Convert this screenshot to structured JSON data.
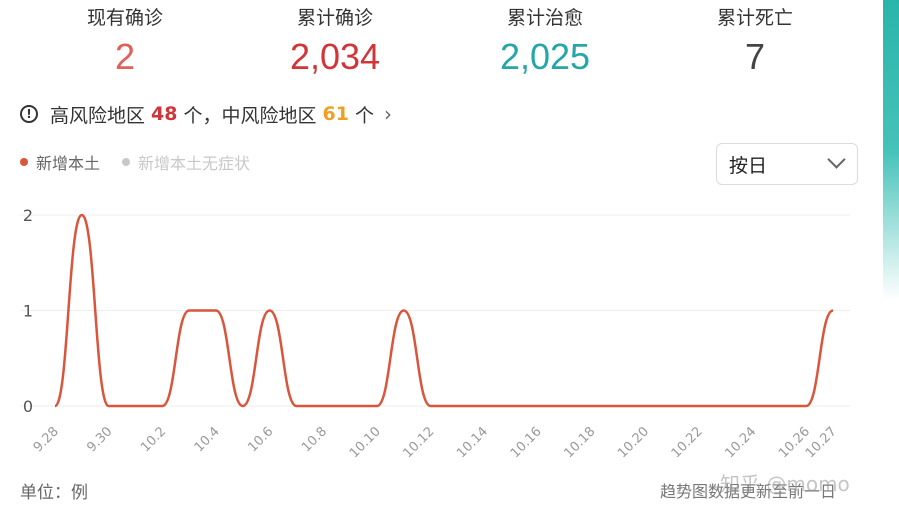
{
  "stats": [
    {
      "label": "现有确诊",
      "value": "2"
    },
    {
      "label": "累计确诊",
      "value": "2,034"
    },
    {
      "label": "累计治愈",
      "value": "2,025"
    },
    {
      "label": "累计死亡",
      "value": "7"
    }
  ],
  "risk": {
    "icon": "!",
    "high_label": "高风险地区",
    "high_count": "48",
    "high_unit": "个，",
    "mid_label": "中风险地区",
    "mid_count": "61",
    "mid_unit": "个",
    "arrow": "›"
  },
  "select": {
    "value": "按日"
  },
  "footer": {
    "unit": "单位：例",
    "note": "趋势图数据更新至前一日",
    "watermark": "知乎 @momo"
  },
  "colors": {
    "series_active": "#d9553c",
    "series_inactive": "#c8c8c8",
    "grid": "#eeeeee"
  },
  "chart_data": {
    "type": "line",
    "ylim": [
      0,
      2
    ],
    "yticks": [
      "0",
      "1",
      "2"
    ],
    "xticks": [
      "9.28",
      "9.30",
      "10.2",
      "10.4",
      "10.6",
      "10.8",
      "10.10",
      "10.12",
      "10.14",
      "10.16",
      "10.18",
      "10.20",
      "10.22",
      "10.24",
      "10.26",
      "10.27"
    ],
    "x": [
      "9.28",
      "9.29",
      "9.30",
      "10.1",
      "10.2",
      "10.3",
      "10.4",
      "10.5",
      "10.6",
      "10.7",
      "10.8",
      "10.9",
      "10.10",
      "10.11",
      "10.12",
      "10.13",
      "10.14",
      "10.15",
      "10.16",
      "10.17",
      "10.18",
      "10.19",
      "10.20",
      "10.21",
      "10.22",
      "10.23",
      "10.24",
      "10.25",
      "10.26",
      "10.27"
    ],
    "series": [
      {
        "name": "新增本土",
        "color": "#d9553c",
        "values": [
          0,
          2,
          0,
          0,
          0,
          1,
          1,
          0,
          1,
          0,
          0,
          0,
          0,
          1,
          0,
          0,
          0,
          0,
          0,
          0,
          0,
          0,
          0,
          0,
          0,
          0,
          0,
          0,
          0,
          1
        ]
      },
      {
        "name": "新增本土无症状",
        "color": "#c8c8c8",
        "values": []
      }
    ],
    "legend_position": "top-left",
    "grid": true
  }
}
